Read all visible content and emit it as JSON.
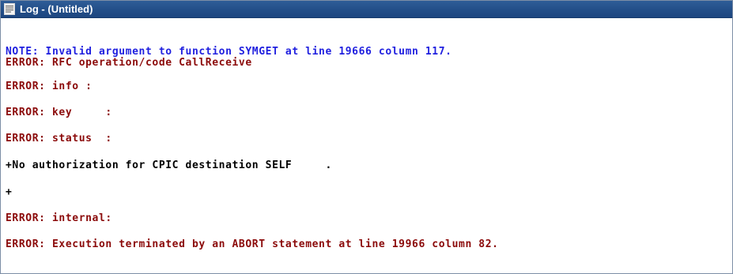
{
  "window": {
    "title": "Log - (Untitled)",
    "icon": "document-icon"
  },
  "colors": {
    "title_bar": "#24508a",
    "note": "#1f1fdf",
    "error": "#8b0a0a",
    "text": "#000000"
  },
  "log": {
    "lines": [
      {
        "text": "NOTE: Invalid argument to function SYMGET at line 19666 column 117.",
        "type": "note"
      },
      {
        "text": "ERROR: RFC operation/code CallReceive",
        "type": "error"
      },
      {
        "text": "ERROR: info :",
        "type": "error"
      },
      {
        "text": "ERROR: key     :",
        "type": "error"
      },
      {
        "text": "ERROR: status  :",
        "type": "error"
      },
      {
        "text": "+No authorization for CPIC destination SELF     .",
        "type": "text"
      },
      {
        "text": "+",
        "type": "text"
      },
      {
        "text": "ERROR: internal:",
        "type": "error"
      },
      {
        "text": "ERROR: Execution terminated by an ABORT statement at line 19966 column 82.",
        "type": "error"
      }
    ]
  }
}
